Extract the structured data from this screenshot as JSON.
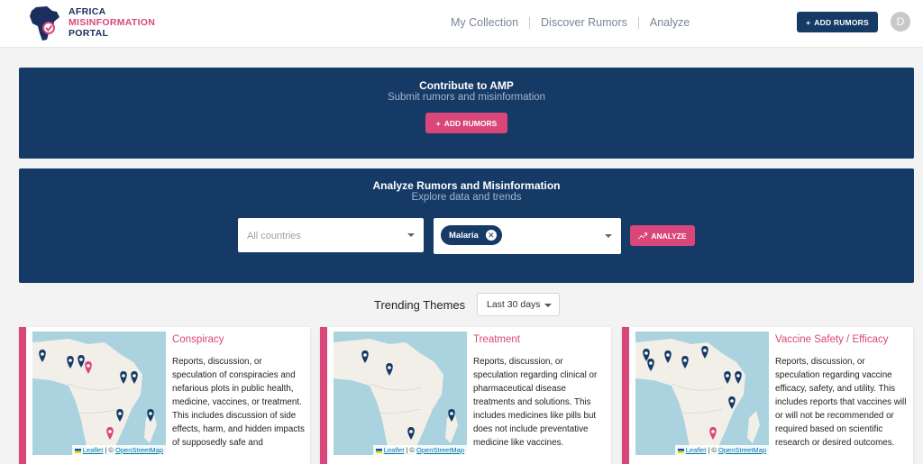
{
  "header": {
    "logo": {
      "line1": "AFRICA",
      "line2": "MISINFORMATION",
      "line3": "PORTAL"
    },
    "nav": [
      {
        "label": "My Collection"
      },
      {
        "label": "Discover Rumors"
      },
      {
        "label": "Analyze"
      }
    ],
    "add_rumors_label": "ADD RUMORS",
    "avatar_initial": "D"
  },
  "contribute": {
    "title": "Contribute to AMP",
    "subtitle": "Submit rumors and misinformation",
    "button_label": "ADD RUMORS"
  },
  "analyze": {
    "title": "Analyze Rumors and Misinformation",
    "subtitle": "Explore data and trends",
    "countries_placeholder": "All countries",
    "selected_topic": "Malaria",
    "button_label": "ANALYZE"
  },
  "trending": {
    "title": "Trending Themes",
    "period": "Last 30 days"
  },
  "map_attribution": {
    "leaflet": "Leaflet",
    "sep": " | © ",
    "osm": "OpenStreetMap"
  },
  "cards": [
    {
      "title": "Conspiracy",
      "description": "Reports, discussion, or speculation of conspiracies and nefarious plots in public health, medicine, vaccines, or treatment. This includes discussion of side effects, harm, and hidden impacts of supposedly safe and"
    },
    {
      "title": "Treatment",
      "description": "Reports, discussion, or speculation regarding clinical or pharmaceutical disease treatments and solutions. This includes medicines like pills but does not include preventative medicine like vaccines."
    },
    {
      "title": "Vaccine Safety / Efficacy",
      "description": "Reports, discussion, or speculation regarding vaccine efficacy, safety, and utility. This includes reports that vaccines will or will not be recommended or required based on scientific research or desired outcomes."
    }
  ],
  "colors": {
    "navy": "#153a66",
    "pink": "#d9467a",
    "map_water": "#aad3df",
    "map_land": "#f2efe9"
  }
}
